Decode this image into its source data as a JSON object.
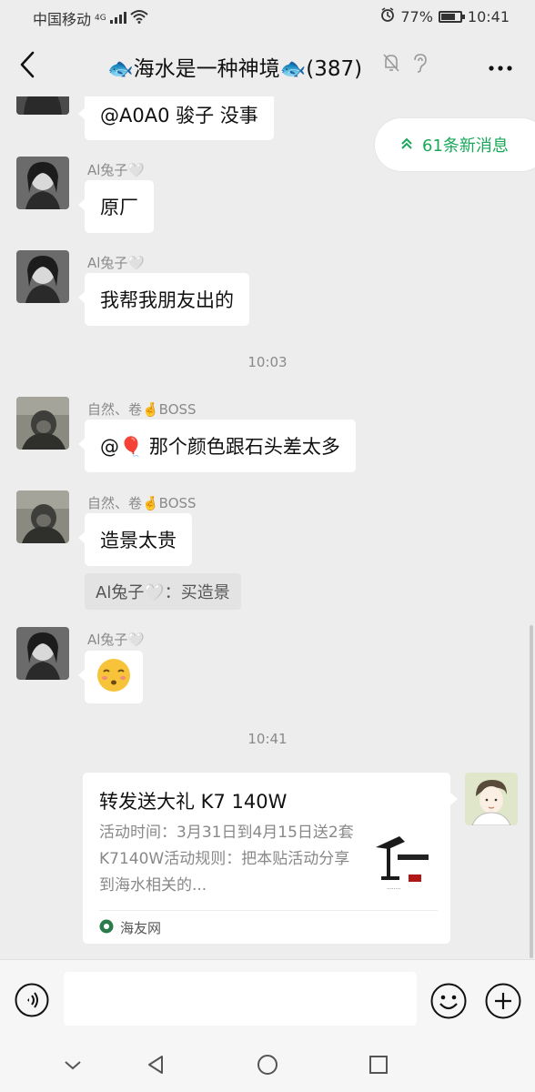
{
  "status": {
    "carrier": "中国移动",
    "network": "4G",
    "battery": "77%",
    "battery_level": 0.77,
    "time": "10:41"
  },
  "header": {
    "title": "🐟海水是一种神境🐟(387)"
  },
  "new_messages": {
    "label": "61条新消息"
  },
  "messages": [
    {
      "id": "m0",
      "sender": "",
      "text": "@A0A0 骏子  没事"
    },
    {
      "id": "m1",
      "sender": "Al兔子🤍",
      "text": "原厂"
    },
    {
      "id": "m2",
      "sender": "Al兔子🤍",
      "text": "我帮我朋友出的"
    },
    {
      "id": "t1",
      "time": "10:03"
    },
    {
      "id": "m3",
      "sender": "自然、卷🤞BOSS",
      "text": "@🎈  那个颜色跟石头差太多"
    },
    {
      "id": "m4",
      "sender": "自然、卷🤞BOSS",
      "text": "造景太贵",
      "quote": "Al兔子🤍：买造景"
    },
    {
      "id": "m5",
      "sender": "Al兔子🤍",
      "text": "😚"
    },
    {
      "id": "t2",
      "time": "10:41"
    }
  ],
  "card": {
    "title": "转发送大礼 K7 140W",
    "description": "活动时间：3月31日到4月15日送2套K7140W活动规则：把本贴活动分享到海水相关的...",
    "source": "海友网"
  },
  "input": {
    "placeholder": ""
  },
  "icons": {
    "back": "chevron-left-icon",
    "mute": "bell-off-icon",
    "earpiece": "ear-icon",
    "more": "more-dots-icon",
    "voice": "voice-icon",
    "emoji": "emoji-icon",
    "plus": "plus-circle-icon"
  },
  "colors": {
    "background": "#ededed",
    "bubble": "#ffffff",
    "accent_green": "#19a859",
    "meta_text": "#8a8a8a"
  }
}
